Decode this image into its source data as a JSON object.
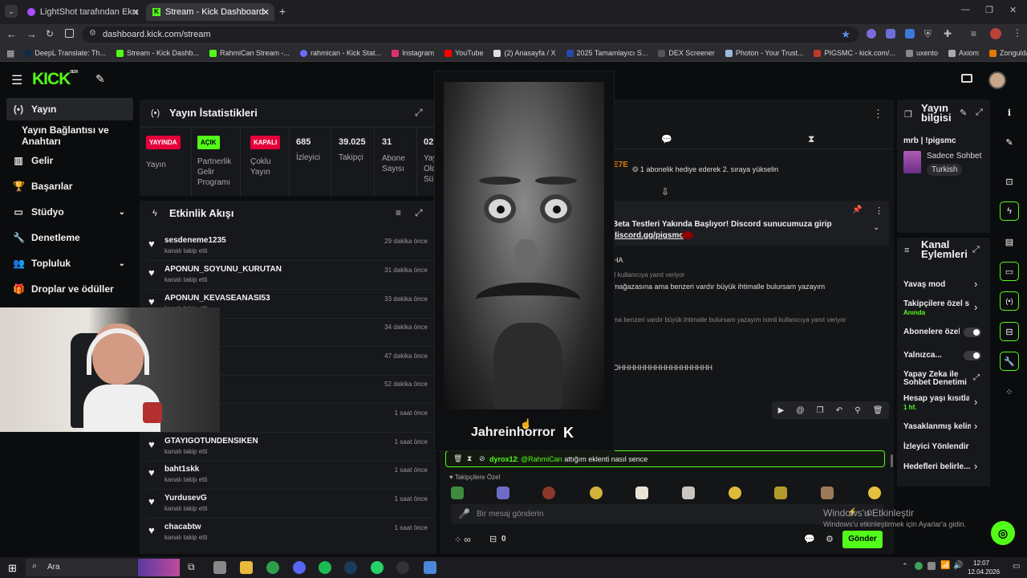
{
  "browser": {
    "tabs": [
      {
        "title": "LightShot tarafından Ekran Görü"
      },
      {
        "title": "Stream - Kick Dashboard"
      }
    ],
    "url": "dashboard.kick.com/stream",
    "bookmarks": [
      "DeepL Translate: Th...",
      "Stream - Kick Dashb...",
      "RahmiCan Stream -...",
      "rahmican - Kick Stat...",
      "Instagram",
      "YouTube",
      "(2) Anasayfa / X",
      "2025 Tamamlayıcı S...",
      "DEX Screener",
      "Photon - Your Trust...",
      "PIGSMC - kick.com/...",
      "uxento",
      "Axiom",
      "Zonguldak İngilizce..."
    ]
  },
  "header": {
    "logo": "KICK",
    "logo_sup": "BETA"
  },
  "sidebar": {
    "items": [
      {
        "label": "Yayın",
        "active": true,
        "icon": "broadcast-icon"
      },
      {
        "label": "Yayın Bağlantısı ve Anahtarı",
        "icon": ""
      },
      {
        "label": "Gelir",
        "icon": "chart-icon"
      },
      {
        "label": "Başarılar",
        "icon": "trophy-icon"
      },
      {
        "label": "Stüdyo",
        "icon": "studio-icon"
      },
      {
        "label": "Denetleme",
        "icon": "wrench-icon"
      },
      {
        "label": "Topluluk",
        "icon": "community-icon"
      },
      {
        "label": "Droplar ve ödüller",
        "icon": "gift-icon"
      }
    ]
  },
  "stats": {
    "title": "Yayın İstatistikleri",
    "items": [
      {
        "badge": "YAYINDA",
        "label": "Yayın"
      },
      {
        "badge": "AÇIK",
        "label": "Partnerlik Gelir Programı"
      },
      {
        "badge": "KAPALI",
        "label": "Çoklu Yayın"
      },
      {
        "value": "685",
        "label": "İzleyici"
      },
      {
        "value": "39.025",
        "label": "Takipçi"
      },
      {
        "value": "31",
        "label": "Abone Sayısı"
      },
      {
        "value": "02",
        "label": "Yay Old Süı"
      }
    ]
  },
  "activity": {
    "title": "Etkinlik Akışı",
    "events": [
      {
        "name": "sesdeneme1235",
        "sub": "kanalı takip etti",
        "time": "29 dakika önce"
      },
      {
        "name": "APONUN_SOYUNU_KURUTAN",
        "sub": "kanalı takip etti",
        "time": "31 dakika önce"
      },
      {
        "name": "APONUN_KEVASEANASI53",
        "sub": "kanalı takip etti",
        "time": "33 dakika önce"
      },
      {
        "name": "",
        "sub": "",
        "time": "34 dakika önce"
      },
      {
        "name": "",
        "sub": "",
        "time": "47 dakika önce"
      },
      {
        "name": "",
        "sub": "",
        "time": "52 dakika önce"
      },
      {
        "name": "",
        "sub": "",
        "time": "1 saat önce"
      },
      {
        "name": "GTAYIGOTUNDENSIKEN",
        "sub": "kanalı takip etti",
        "time": "1 saat önce"
      },
      {
        "name": "baht1skk",
        "sub": "kanalı takip etti",
        "time": "1 saat önce"
      },
      {
        "name": "YurdusevG",
        "sub": "kanalı takip etti",
        "time": "1 saat önce"
      },
      {
        "name": "chacabtw",
        "sub": "kanalı takip etti",
        "time": "1 saat önce"
      }
    ]
  },
  "popup": {
    "name": "Jahreinhorror"
  },
  "chat": {
    "top_name": "E7E",
    "gift_note": "1 abonelik hediye ederek 2. sıraya yükselin",
    "pinned": "Beta Testleri Yakında Başlıyor! Discord sunucumuza girip",
    "pinned_link": "discord.gg/pigsmc",
    "lines": [
      "HA",
      "il kullanıcıya yanıt veriyor",
      "mağazasına ama benzeri vardır büyük ihtimalle bulursam yazayım",
      "ma benzeri vardır büyük ihtimalle bulursam yazayım isimli kullanıcıya yanıt veriyor",
      "OHHHHHHHHHHHHHHHHHH"
    ],
    "highlight_user": "dyrox12",
    "highlight_mention": "@RahmiCan",
    "highlight_text": "attığım eklenti nasıl sence",
    "follower_only": "Takipçilere Özel",
    "input_placeholder": "Bir mesaj gönderin",
    "count": "0",
    "send": "Gönder",
    "infinity": "∞"
  },
  "stream_info": {
    "title": "Yayın bilgisi",
    "stream_title": "mrb | !pigsmc",
    "category": "Sadece Sohbet",
    "tag": "Turkish"
  },
  "channel_actions": {
    "title": "Kanal Eylemleri",
    "items": [
      {
        "label": "Yavaş mod",
        "kind": "arrow"
      },
      {
        "label": "Takipçilere özel sohbet",
        "sub": "Anında",
        "kind": "arrow"
      },
      {
        "label": "Abonelere özel",
        "kind": "toggle"
      },
      {
        "label": "Yalnızca...",
        "kind": "toggle"
      },
      {
        "label": "Yapay Zeka ile Sohbet Denetimi",
        "kind": "link"
      },
      {
        "label": "Hesap yaşı kısıtlaması",
        "sub": "1 hf.",
        "kind": "arrow"
      },
      {
        "label": "Yasaklanmış kelimeler",
        "kind": "arrow"
      },
      {
        "label": "İzleyici Yönlendir",
        "kind": "none"
      },
      {
        "label": "Hedefleri belirle...",
        "kind": "arrow"
      }
    ]
  },
  "windows": {
    "activate_title": "Windows'u Etkinleştir",
    "activate_sub": "Windows'u etkinleştirmek için Ayarlar'a gidin.",
    "search": "Ara",
    "time": "12:07",
    "date": "12.04.2026"
  },
  "colors": {
    "accent": "#53fc18",
    "live": "#e4003a",
    "panel": "#17181b",
    "bg": "#0b0c0e"
  }
}
